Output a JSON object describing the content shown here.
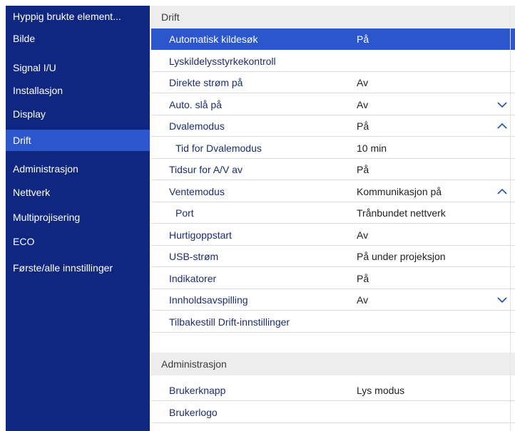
{
  "sidebar": {
    "items": [
      {
        "label": "Hyppig brukte element..."
      },
      {
        "label": "Bilde"
      },
      {
        "label": "Signal I/U"
      },
      {
        "label": "Installasjon"
      },
      {
        "label": "Display"
      },
      {
        "label": "Drift",
        "selected": true
      },
      {
        "label": "Administrasjon"
      },
      {
        "label": "Nettverk"
      },
      {
        "label": "Multiprojisering"
      },
      {
        "label": "ECO"
      },
      {
        "label": "Første/alle innstillinger"
      }
    ]
  },
  "main": {
    "section1_title": "Drift",
    "rows": [
      {
        "label": "Automatisk kildesøk",
        "value": "På",
        "selected": true
      },
      {
        "label": "Lyskildelysstyrkekontroll",
        "value": ""
      },
      {
        "label": "Direkte strøm på",
        "value": "Av"
      },
      {
        "label": "Auto. slå på",
        "value": "Av",
        "arrow": "chevron-down-icon"
      },
      {
        "label": "Dvalemodus",
        "value": "På",
        "arrow": "chevron-up-icon"
      },
      {
        "label": "Tid for Dvalemodus",
        "value": "10 min",
        "sub": true
      },
      {
        "label": "Tidsur for A/V av",
        "value": "På"
      },
      {
        "label": "Ventemodus",
        "value": "Kommunikasjon på",
        "arrow": "chevron-up-icon"
      },
      {
        "label": "Port",
        "value": "Trånbundet nettverk",
        "sub": true
      },
      {
        "label": "Hurtigoppstart",
        "value": "Av"
      },
      {
        "label": "USB-strøm",
        "value": "På under projeksjon"
      },
      {
        "label": "Indikatorer",
        "value": "På"
      },
      {
        "label": "Innholdsavspilling",
        "value": "Av",
        "arrow": "chevron-down-icon"
      },
      {
        "label": "Tilbakestill Drift-innstillinger",
        "value": ""
      }
    ],
    "section2_title": "Administrasjon",
    "rows2": [
      {
        "label": "Brukerknapp",
        "value": "Lys modus"
      },
      {
        "label": "Brukerlogo",
        "value": ""
      }
    ]
  },
  "colors": {
    "sidebar_bg": "#0f2780",
    "selected_bg": "#2c57cc",
    "section_header_bg": "#ededed",
    "row_text": "#1d2d6b"
  }
}
